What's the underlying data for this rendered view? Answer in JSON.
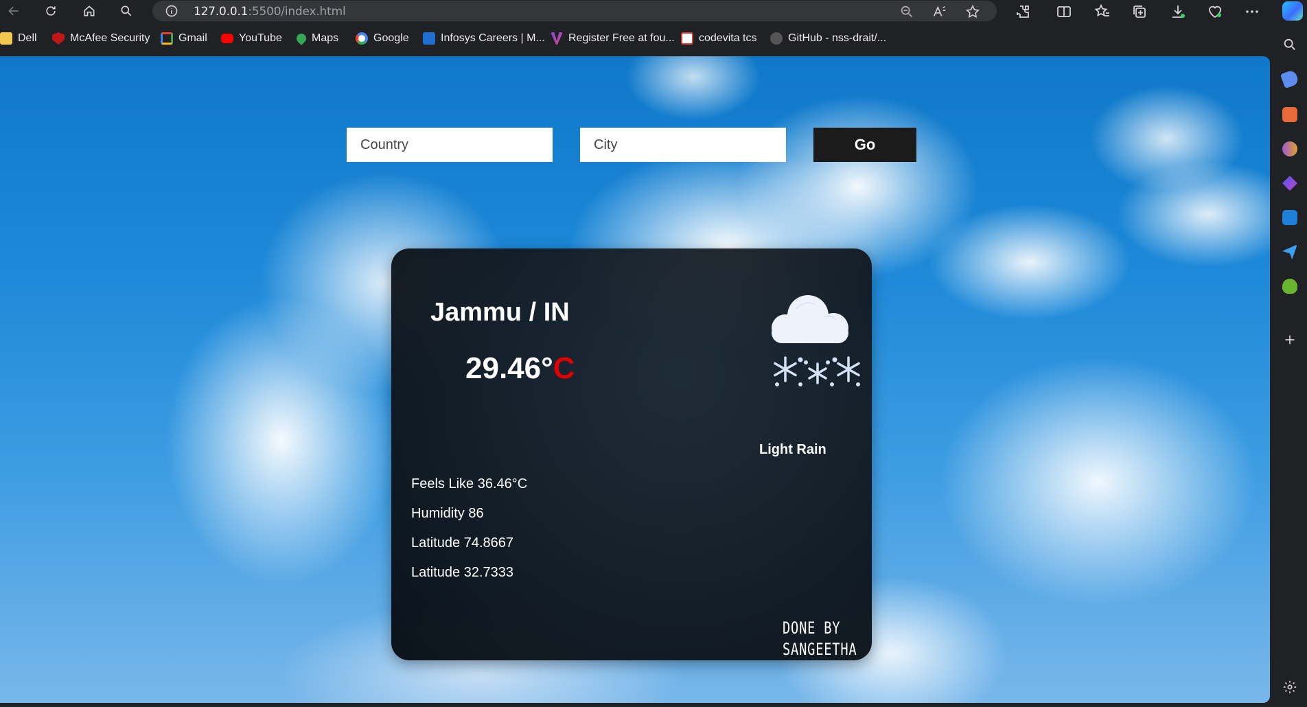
{
  "browser": {
    "url_host": "127.0.0.1",
    "url_rest": ":5500/index.html"
  },
  "bookmarks": [
    {
      "label": "Dell",
      "icon": "folder-icon",
      "color": "#f2c94c"
    },
    {
      "label": "McAfee Security",
      "icon": "mcafee-icon",
      "color": "#c01818"
    },
    {
      "label": "Gmail",
      "icon": "gmail-icon",
      "color": "#ea4335"
    },
    {
      "label": "YouTube",
      "icon": "youtube-icon",
      "color": "#ff0000"
    },
    {
      "label": "Maps",
      "icon": "maps-icon",
      "color": "#34a853"
    },
    {
      "label": "Google",
      "icon": "google-icon",
      "color": "#4285f4"
    },
    {
      "label": "Infosys Careers | M...",
      "icon": "infosys-icon",
      "color": "#1f6fd1"
    },
    {
      "label": "Register Free at fou...",
      "icon": "register-icon",
      "color": "#7b4cd8"
    },
    {
      "label": "codevita tcs",
      "icon": "tcs-icon",
      "color": "#d83b3b"
    },
    {
      "label": "GitHub - nss-drait/...",
      "icon": "github-icon",
      "color": "#555555"
    }
  ],
  "search": {
    "country_placeholder": "Country",
    "city_placeholder": "City",
    "go_label": "Go"
  },
  "weather": {
    "location": "Jammu / IN",
    "temp_value": "29.46°",
    "temp_unit": "C",
    "description": "Light Rain",
    "icon": "cloud-snow-icon",
    "details": [
      "Feels Like 36.46°C",
      "Humidity 86",
      "Latitude 74.8667",
      "Latitude 32.7333"
    ],
    "credit_line1": "DONE BY",
    "credit_line2": "SANGEETHA"
  },
  "colors": {
    "temp_unit": "#e00000",
    "card_bg": "#0b1118",
    "go_button_bg": "#1b1b1b"
  }
}
